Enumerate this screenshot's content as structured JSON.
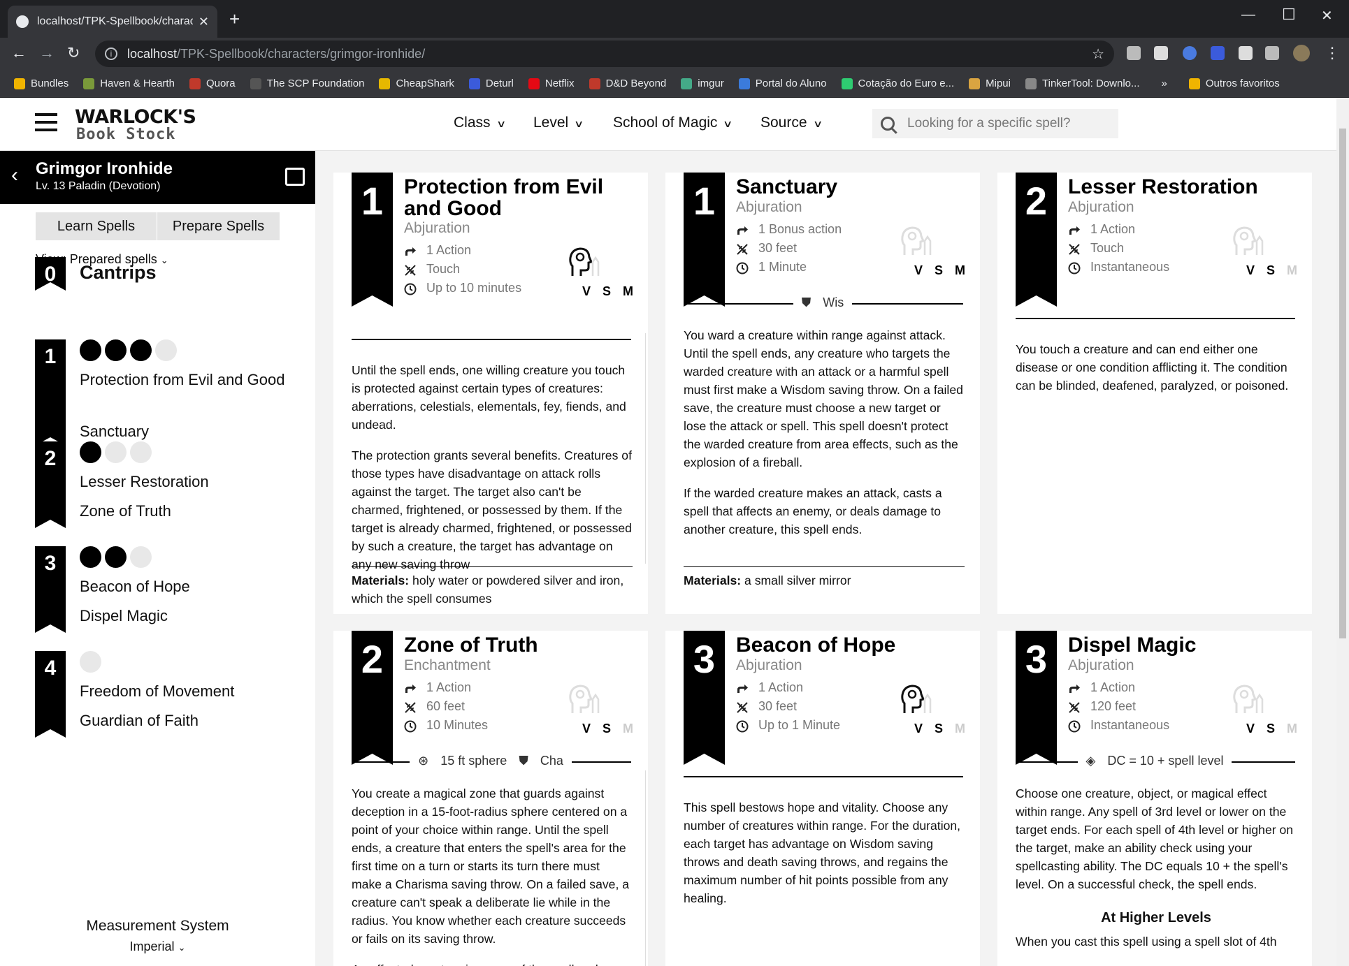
{
  "browser": {
    "tab_title": "localhost/TPK-Spellbook/charact",
    "url_host": "localhost",
    "url_path": "/TPK-Spellbook/characters/grimgor-ironhide/",
    "bookmarks": [
      "Bundles",
      "Haven & Hearth",
      "Quora",
      "The SCP Foundation",
      "CheapShark",
      "Deturl",
      "Netflix",
      "D&D Beyond",
      "imgur",
      "Portal do Aluno",
      "Cotação do Euro e...",
      "Mipui",
      "TinkerTool: Downlo..."
    ],
    "bookmarks_more": "»",
    "other_bookmarks": "Outros favoritos",
    "bookmark_colors": [
      "#f0b400",
      "#7a9a3a",
      "#c0392b",
      "#555",
      "#e6b800",
      "#3b5bdb",
      "#e50914",
      "#c0392b",
      "#4a8",
      "#3b7bdb",
      "#2ecc71",
      "#d9a441",
      "#888"
    ]
  },
  "header": {
    "logo_line1": "WARLOCK'S",
    "logo_line2": "Book Stock",
    "filters": [
      "Class",
      "Level",
      "School of Magic",
      "Source"
    ],
    "search_placeholder": "Looking for a specific spell?"
  },
  "sidebar": {
    "character_name": "Grimgor Ironhide",
    "character_sub": "Lv. 13 Paladin (Devotion)",
    "learn_label": "Learn Spells",
    "prepare_label": "Prepare Spells",
    "view_label": "View: Prepared spells",
    "levels": [
      {
        "level": "0",
        "name": "Cantrips",
        "slots": [],
        "spells": []
      },
      {
        "level": "1",
        "slots": [
          true,
          true,
          true,
          false
        ],
        "spells": [
          "Protection from Evil and Good",
          "Sanctuary"
        ]
      },
      {
        "level": "2",
        "slots": [
          true,
          false,
          false
        ],
        "spells": [
          "Lesser Restoration",
          "Zone of Truth"
        ]
      },
      {
        "level": "3",
        "slots": [
          true,
          true,
          false
        ],
        "spells": [
          "Beacon of Hope",
          "Dispel Magic"
        ]
      },
      {
        "level": "4",
        "slots": [
          false
        ],
        "spells": [
          "Freedom of Movement",
          "Guardian of Faith"
        ]
      }
    ],
    "measurement_title": "Measurement System",
    "measurement_value": "Imperial"
  },
  "cards": [
    {
      "level": "1",
      "title": "Protection from Evil and Good",
      "school": "Abjuration",
      "time": "1 Action",
      "range": "Touch",
      "duration": "Up to 10 minutes",
      "components": {
        "v": true,
        "s": true,
        "m": true
      },
      "concentration": true,
      "desc": [
        "Until the spell ends, one willing creature you touch is protected against certain types of creatures: aberrations, celestials, elementals, fey, fiends, and undead.",
        "The protection grants several benefits. Creatures of those types have disadvantage on attack rolls against the target. The target also can't be charmed, frightened, or possessed by them. If the target is already charmed, frightened, or possessed by such a creature, the target has advantage on any new saving throw"
      ],
      "materials": "holy water or powdered silver and iron, which the spell consumes"
    },
    {
      "level": "1",
      "title": "Sanctuary",
      "school": "Abjuration",
      "time": "1 Bonus action",
      "range": "30 feet",
      "duration": "1 Minute",
      "components": {
        "v": true,
        "s": true,
        "m": true
      },
      "concentration": false,
      "save": "Wis",
      "desc": [
        "You ward a creature within range against attack. Until the spell ends, any creature who targets the warded creature with an attack or a harmful spell must first make a Wisdom saving throw. On a failed save, the creature must choose a new target or lose the attack or spell. This spell doesn't protect the warded creature from area effects, such as the explosion of a fireball.",
        "If the warded creature makes an attack, casts a spell that affects an enemy, or deals damage to another creature, this spell ends."
      ],
      "materials": "a small silver mirror"
    },
    {
      "level": "2",
      "title": "Lesser Restoration",
      "school": "Abjuration",
      "time": "1 Action",
      "range": "Touch",
      "duration": "Instantaneous",
      "components": {
        "v": true,
        "s": true,
        "m": false
      },
      "concentration": false,
      "desc": [
        "You touch a creature and can end either one disease or one condition afflicting it. The condition can be blinded, deafened, paralyzed, or poisoned."
      ]
    },
    {
      "level": "2",
      "title": "Zone of Truth",
      "school": "Enchantment",
      "time": "1 Action",
      "range": "60 feet",
      "duration": "10 Minutes",
      "components": {
        "v": true,
        "s": true,
        "m": false
      },
      "concentration": false,
      "area": "15 ft sphere",
      "save": "Cha",
      "desc": [
        "You create a magical zone that guards against deception in a 15-foot-radius sphere centered on a point of your choice within range. Until the spell ends, a creature that enters the spell's area for the first time on a turn or starts its turn there must make a Charisma saving throw. On a failed save, a creature can't speak a deliberate lie while in the radius. You know whether each creature succeeds or fails on its saving throw.",
        "An affected creature is aware of the spell and"
      ]
    },
    {
      "level": "3",
      "title": "Beacon of Hope",
      "school": "Abjuration",
      "time": "1 Action",
      "range": "30 feet",
      "duration": "Up to 1 Minute",
      "components": {
        "v": true,
        "s": true,
        "m": false
      },
      "concentration": true,
      "desc": [
        "This spell bestows hope and vitality. Choose any number of creatures within range. For the duration, each target has advantage on Wisdom saving throws and death saving throws, and regains the maximum number of hit points possible from any healing."
      ]
    },
    {
      "level": "3",
      "title": "Dispel Magic",
      "school": "Abjuration",
      "time": "1 Action",
      "range": "120 feet",
      "duration": "Instantaneous",
      "components": {
        "v": true,
        "s": true,
        "m": false
      },
      "concentration": false,
      "dc": "DC = 10 + spell level",
      "desc": [
        "Choose one creature, object, or magical effect within range. Any spell of 3rd level or lower on the target ends. For each spell of 4th level or higher on the target, make an ability check using your spellcasting ability. The DC equals 10 + the spell's level. On a successful check, the spell ends."
      ],
      "higher_title": "At Higher Levels",
      "higher_text": "When you cast this spell using a spell slot of 4th"
    }
  ],
  "materials_label": "Materials:"
}
